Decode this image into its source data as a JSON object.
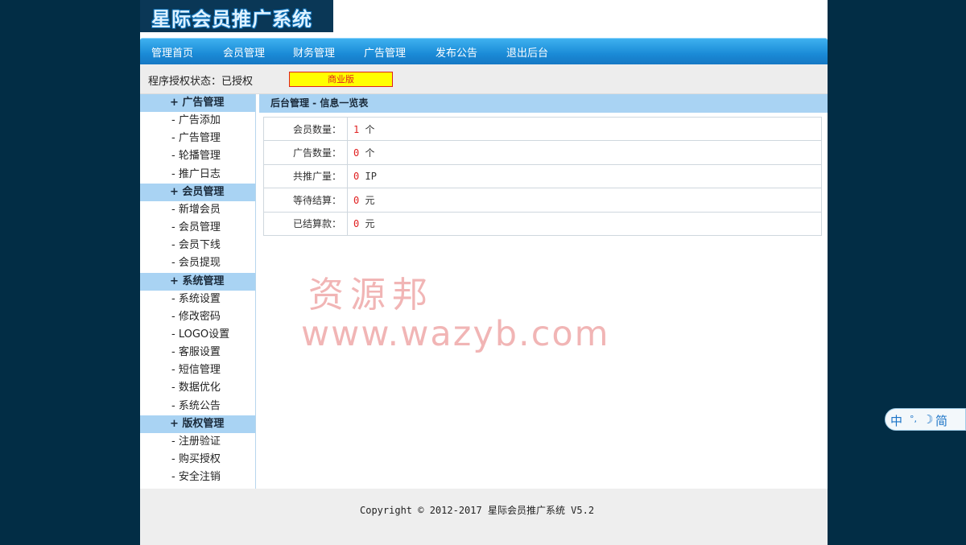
{
  "header": {
    "logo_text": "星际会员推广系统"
  },
  "nav": {
    "items": [
      "管理首页",
      "会员管理",
      "财务管理",
      "广告管理",
      "发布公告",
      "退出后台"
    ]
  },
  "status": {
    "label": "程序授权状态：已授权",
    "license_badge": "商业版"
  },
  "sidebar": {
    "groups": [
      {
        "title": "+ 广告管理",
        "items": [
          "- 广告添加",
          "- 广告管理",
          "- 轮播管理",
          "- 推广日志"
        ]
      },
      {
        "title": "+ 会员管理",
        "items": [
          "- 新增会员",
          "- 会员管理",
          "- 会员下线",
          "- 会员提现"
        ]
      },
      {
        "title": "+ 系统管理",
        "items": [
          "- 系统设置",
          "- 修改密码",
          "- LOGO设置",
          "- 客服设置",
          "- 短信管理",
          "- 数据优化",
          "- 系统公告"
        ]
      },
      {
        "title": "+ 版权管理",
        "items": [
          "- 注册验证",
          "- 购买授权",
          "- 安全注销"
        ]
      }
    ]
  },
  "main": {
    "title": "后台管理 - 信息一览表",
    "rows": [
      {
        "label": "会员数量：",
        "value": "1",
        "unit": "个"
      },
      {
        "label": "广告数量：",
        "value": "0",
        "unit": "个"
      },
      {
        "label": "共推广量：",
        "value": "0",
        "unit": "IP"
      },
      {
        "label": "等待结算：",
        "value": "0",
        "unit": " 元"
      },
      {
        "label": "已结算款：",
        "value": "0",
        "unit": " 元"
      }
    ]
  },
  "watermark": {
    "line1": "资源邦",
    "line2": "www.wazyb.com"
  },
  "footer": {
    "text": "Copyright © 2012-2017 星际会员推广系统 V5.2"
  },
  "ime": {
    "mode": "中",
    "punct": "°,",
    "moon": "☽",
    "simplified": "简"
  }
}
